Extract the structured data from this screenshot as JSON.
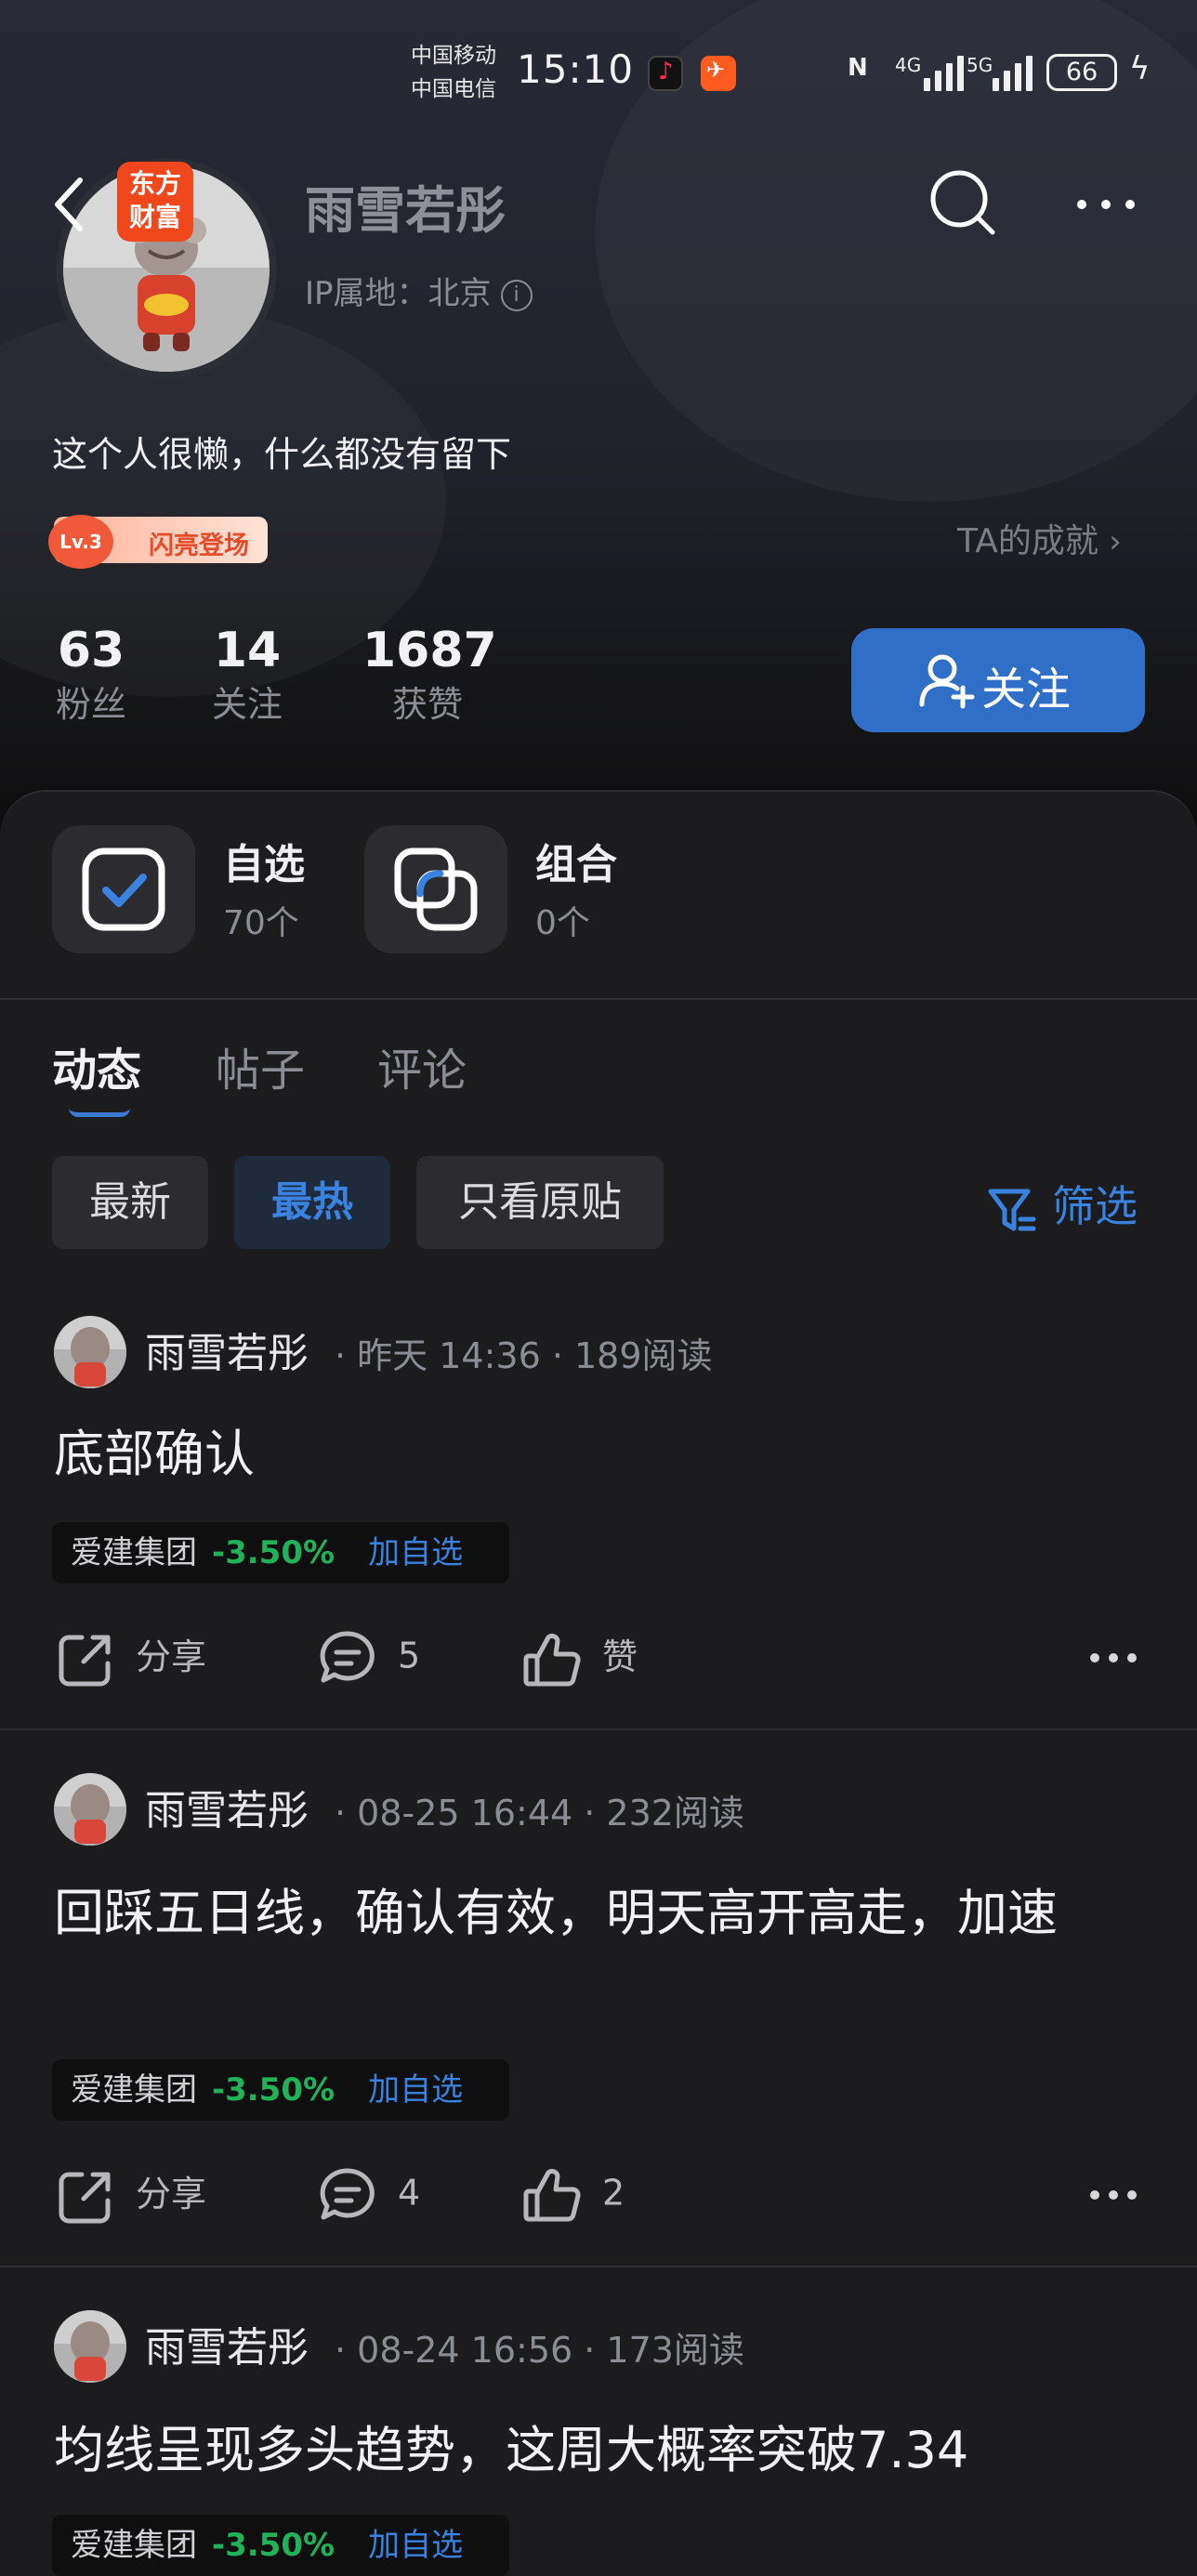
{
  "status_bar": {
    "carrier_1": "中国移动",
    "carrier_2": "中国电信",
    "time": "15:10",
    "network_1": "4G",
    "network_2": "5G",
    "battery": "66"
  },
  "profile": {
    "brand_badge": "东方财富",
    "username": "雨雪若彤",
    "ip_location": "IP属地：北京",
    "bio": "这个人很懒，什么都没有留下",
    "level": "Lv.3",
    "level_title": "闪亮登场",
    "achievements_link": "TA的成就",
    "stats": [
      {
        "num": "63",
        "label": "粉丝"
      },
      {
        "num": "14",
        "label": "关注"
      },
      {
        "num": "1687",
        "label": "获赞"
      }
    ],
    "follow_label": "关注"
  },
  "quick_access": [
    {
      "title": "自选",
      "sub": "70个",
      "icon": "checkbox-icon"
    },
    {
      "title": "组合",
      "sub": "0个",
      "icon": "combo-icon"
    }
  ],
  "tabs": [
    "动态",
    "帖子",
    "评论"
  ],
  "active_tab": "动态",
  "chips": [
    "最新",
    "最热",
    "只看原贴"
  ],
  "active_chip": "最热",
  "filter_label": "筛选",
  "posts": [
    {
      "author": "雨雪若彤",
      "meta": "· 昨天 14:36 · 189阅读",
      "text": "底部确认",
      "stock": {
        "name": "爱建集团",
        "change": "-3.50%",
        "add": "加自选"
      },
      "share": "分享",
      "comments": "5",
      "likes": "赞"
    },
    {
      "author": "雨雪若彤",
      "meta": "· 08-25 16:44 · 232阅读",
      "text": "回踩五日线，确认有效，明天高开高走，加速",
      "stock": {
        "name": "爱建集团",
        "change": "-3.50%",
        "add": "加自选"
      },
      "share": "分享",
      "comments": "4",
      "likes": "2"
    },
    {
      "author": "雨雪若彤",
      "meta": "· 08-24 16:56 · 173阅读",
      "text": "均线呈现多头趋势，这周大概率突破7.34",
      "stock": {
        "name": "爱建集团",
        "change": "-3.50%",
        "add": "加自选"
      }
    }
  ],
  "colors": {
    "accent_blue": "#3a82e0",
    "follow_button": "#2f6fc7",
    "stock_down_green": "#21b259",
    "brand_orange": "#f0471c",
    "background": "#1c1c1e"
  }
}
